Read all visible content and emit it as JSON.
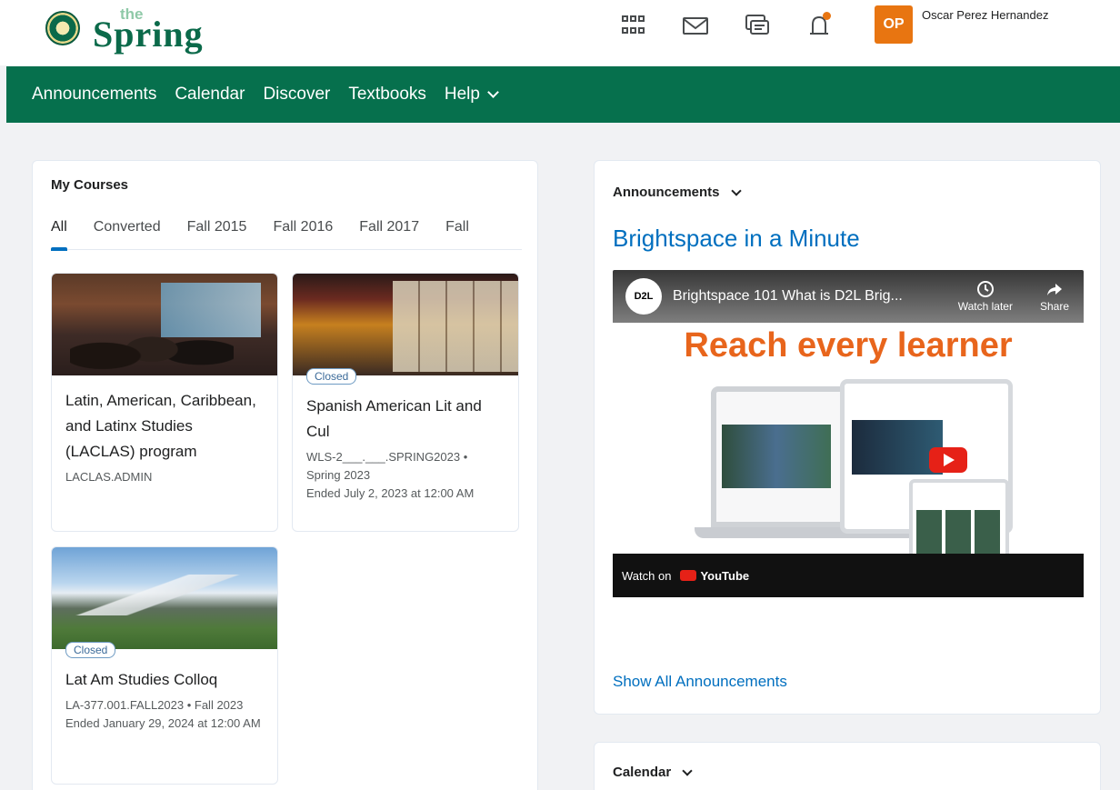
{
  "header": {
    "logo_small": "the",
    "logo_word": "Spring",
    "user_name": "Oscar Perez Hernandez",
    "avatar_initials": "OP",
    "icons": [
      "grid-icon",
      "mail-icon",
      "chat-icon",
      "bell-icon"
    ]
  },
  "nav": {
    "items": [
      "Announcements",
      "Calendar",
      "Discover",
      "Textbooks",
      "Help"
    ]
  },
  "courses": {
    "title": "My Courses",
    "tabs": [
      "All",
      "Converted",
      "Fall 2015",
      "Fall 2016",
      "Fall 2017",
      "Fall"
    ],
    "cards": [
      {
        "title": "Latin, American, Caribbean, and Latinx Studies (LACLAS) program",
        "code": "LACLAS.ADMIN",
        "ended": "",
        "badge": ""
      },
      {
        "title": "Spanish American Lit and Cul",
        "code": "WLS-2___.___.SPRING2023 •",
        "term": "Spring 2023",
        "ended": "Ended July 2, 2023 at 12:00 AM",
        "badge": "Closed"
      },
      {
        "title": "Lat Am Studies Colloq",
        "code": "LA-377.001.FALL2023 • Fall 2023",
        "ended": "Ended January 29, 2024 at 12:00 AM",
        "badge": "Closed"
      }
    ]
  },
  "announcements": {
    "title": "Announcements",
    "heading": "Brightspace in a Minute",
    "video": {
      "logo": "D2L",
      "title": "Brightspace 101 What is D2L Brig...",
      "watch_later": "Watch later",
      "share": "Share",
      "banner": "Reach every learner",
      "watch_on": "Watch on",
      "youtube": "YouTube"
    },
    "show_all": "Show All Announcements"
  },
  "calendar": {
    "title": "Calendar"
  },
  "colors": {
    "nav_green": "#06704d",
    "link_blue": "#006fbf",
    "accent_orange": "#e87511"
  }
}
